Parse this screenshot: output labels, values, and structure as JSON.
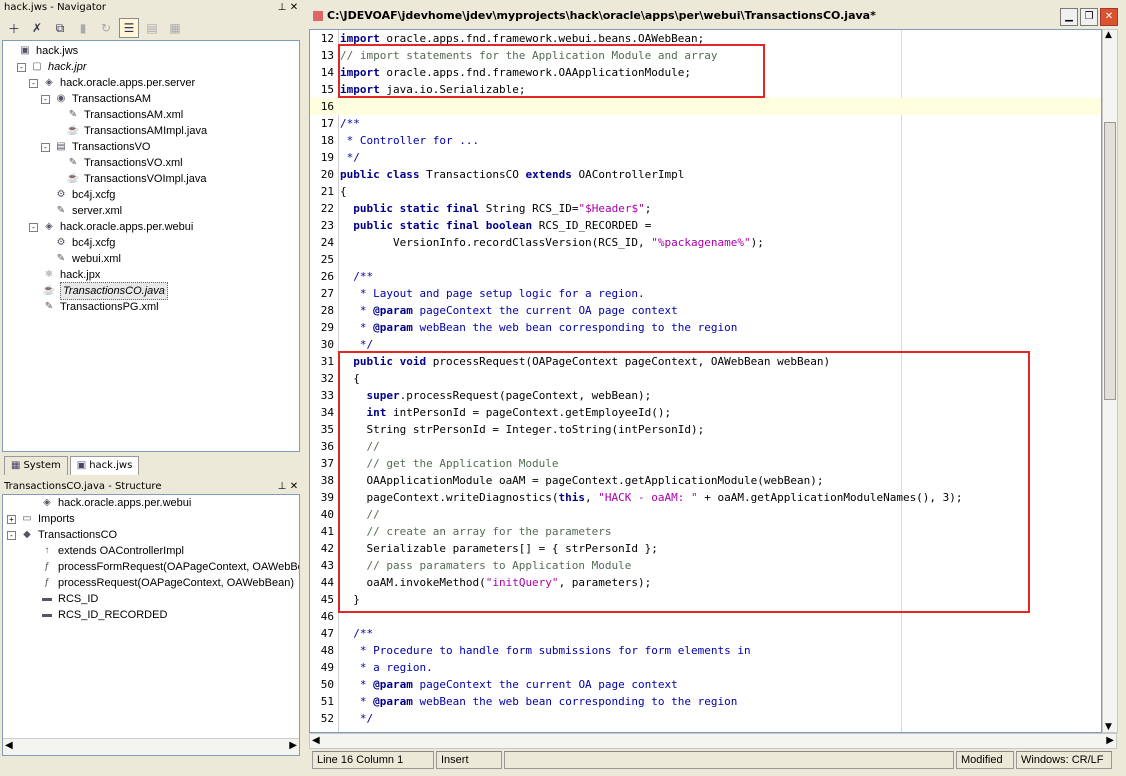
{
  "navigator": {
    "title": "hack.jws - Navigator",
    "tree": [
      {
        "label": "hack.jws",
        "depth": 0,
        "icon": "workspace-icon",
        "expand": ""
      },
      {
        "label": "hack.jpr",
        "depth": 1,
        "icon": "project-icon",
        "expand": "-",
        "italic": true
      },
      {
        "label": "hack.oracle.apps.per.server",
        "depth": 2,
        "icon": "package-icon",
        "expand": "-"
      },
      {
        "label": "TransactionsAM",
        "depth": 3,
        "icon": "app-module-icon",
        "expand": "-"
      },
      {
        "label": "TransactionsAM.xml",
        "depth": 4,
        "icon": "xml-file-icon",
        "expand": ""
      },
      {
        "label": "TransactionsAMImpl.java",
        "depth": 4,
        "icon": "java-file-icon",
        "expand": ""
      },
      {
        "label": "TransactionsVO",
        "depth": 3,
        "icon": "view-object-icon",
        "expand": "-"
      },
      {
        "label": "TransactionsVO.xml",
        "depth": 4,
        "icon": "xml-file-icon",
        "expand": ""
      },
      {
        "label": "TransactionsVOImpl.java",
        "depth": 4,
        "icon": "java-file-icon",
        "expand": ""
      },
      {
        "label": "bc4j.xcfg",
        "depth": 3,
        "icon": "config-file-icon",
        "expand": ""
      },
      {
        "label": "server.xml",
        "depth": 3,
        "icon": "xml-file-icon",
        "expand": ""
      },
      {
        "label": "hack.oracle.apps.per.webui",
        "depth": 2,
        "icon": "package-icon",
        "expand": "-"
      },
      {
        "label": "bc4j.xcfg",
        "depth": 3,
        "icon": "config-file-icon",
        "expand": ""
      },
      {
        "label": "webui.xml",
        "depth": 3,
        "icon": "xml-file-icon",
        "expand": ""
      },
      {
        "label": "hack.jpx",
        "depth": 2,
        "icon": "jpx-file-icon",
        "expand": ""
      },
      {
        "label": "TransactionsCO.java",
        "depth": 2,
        "icon": "java-file-icon",
        "expand": "",
        "italic": true,
        "selected": true
      },
      {
        "label": "TransactionsPG.xml",
        "depth": 2,
        "icon": "xml-file-icon",
        "expand": ""
      }
    ],
    "tabs": [
      {
        "label": "System",
        "icon": "system-icon"
      },
      {
        "label": "hack.jws",
        "icon": "workspace-icon",
        "active": true
      }
    ]
  },
  "structure": {
    "title": "TransactionsCO.java - Structure",
    "tree": [
      {
        "label": "hack.oracle.apps.per.webui",
        "depth": 1,
        "icon": "package-icon",
        "expand": ""
      },
      {
        "label": "Imports",
        "depth": 0,
        "icon": "imports-icon",
        "expand": "+"
      },
      {
        "label": "TransactionsCO",
        "depth": 0,
        "icon": "class-icon",
        "expand": "-"
      },
      {
        "label": "extends OAControllerImpl",
        "depth": 1,
        "icon": "extends-icon",
        "expand": ""
      },
      {
        "label": "processFormRequest(OAPageContext, OAWebBe",
        "depth": 1,
        "icon": "method-icon",
        "expand": ""
      },
      {
        "label": "processRequest(OAPageContext, OAWebBean)",
        "depth": 1,
        "icon": "method-icon",
        "expand": ""
      },
      {
        "label": "RCS_ID",
        "depth": 1,
        "icon": "field-icon",
        "expand": ""
      },
      {
        "label": "RCS_ID_RECORDED",
        "depth": 1,
        "icon": "field-icon",
        "expand": ""
      }
    ]
  },
  "editor": {
    "title": "C:\\JDEVOAF\\jdevhome\\jdev\\myprojects\\hack\\oracle\\apps\\per\\webui\\TransactionsCO.java*",
    "current_line": 16,
    "lines": [
      {
        "n": "12",
        "t": "import oracle.apps.fnd.framework.webui.beans.OAWebBean;"
      },
      {
        "n": "13",
        "t": "// import statements for the Application Module and array"
      },
      {
        "n": "14",
        "t": "import oracle.apps.fnd.framework.OAApplicationModule;"
      },
      {
        "n": "15",
        "t": "import java.io.Serializable;"
      },
      {
        "n": "16",
        "t": ""
      },
      {
        "n": "17",
        "t": "/**"
      },
      {
        "n": "18",
        "t": " * Controller for ..."
      },
      {
        "n": "19",
        "t": " */"
      },
      {
        "n": "20",
        "t": "public class TransactionsCO extends OAControllerImpl"
      },
      {
        "n": "21",
        "t": "{"
      },
      {
        "n": "22",
        "t": "  public static final String RCS_ID=\"$Header$\";"
      },
      {
        "n": "23",
        "t": "  public static final boolean RCS_ID_RECORDED ="
      },
      {
        "n": "24",
        "t": "        VersionInfo.recordClassVersion(RCS_ID, \"%packagename%\");"
      },
      {
        "n": "25",
        "t": ""
      },
      {
        "n": "26",
        "t": "  /**"
      },
      {
        "n": "27",
        "t": "   * Layout and page setup logic for a region."
      },
      {
        "n": "28",
        "t": "   * @param pageContext the current OA page context"
      },
      {
        "n": "29",
        "t": "   * @param webBean the web bean corresponding to the region"
      },
      {
        "n": "30",
        "t": "   */"
      },
      {
        "n": "31",
        "t": "  public void processRequest(OAPageContext pageContext, OAWebBean webBean)"
      },
      {
        "n": "32",
        "t": "  {"
      },
      {
        "n": "33",
        "t": "    super.processRequest(pageContext, webBean);"
      },
      {
        "n": "34",
        "t": "    int intPersonId = pageContext.getEmployeeId();"
      },
      {
        "n": "35",
        "t": "    String strPersonId = Integer.toString(intPersonId);"
      },
      {
        "n": "36",
        "t": "    //"
      },
      {
        "n": "37",
        "t": "    // get the Application Module"
      },
      {
        "n": "38",
        "t": "    OAApplicationModule oaAM = pageContext.getApplicationModule(webBean);"
      },
      {
        "n": "39",
        "t": "    pageContext.writeDiagnostics(this, \"HACK - oaAM: \" + oaAM.getApplicationModuleNames(), 3);"
      },
      {
        "n": "40",
        "t": "    //"
      },
      {
        "n": "41",
        "t": "    // create an array for the parameters"
      },
      {
        "n": "42",
        "t": "    Serializable parameters[] = { strPersonId };"
      },
      {
        "n": "43",
        "t": "    // pass paramaters to Application Module"
      },
      {
        "n": "44",
        "t": "    oaAM.invokeMethod(\"initQuery\", parameters);"
      },
      {
        "n": "45",
        "t": "  }"
      },
      {
        "n": "46",
        "t": ""
      },
      {
        "n": "47",
        "t": "  /**"
      },
      {
        "n": "48",
        "t": "   * Procedure to handle form submissions for form elements in"
      },
      {
        "n": "49",
        "t": "   * a region."
      },
      {
        "n": "50",
        "t": "   * @param pageContext the current OA page context"
      },
      {
        "n": "51",
        "t": "   * @param webBean the web bean corresponding to the region"
      },
      {
        "n": "52",
        "t": "   */"
      }
    ]
  },
  "status": {
    "position": "Line 16 Column 1",
    "mode": "Insert",
    "modified": "Modified",
    "line_ending": "Windows: CR/LF"
  },
  "colors": {
    "highlight_box": "#e32626",
    "keyword": "#00008b",
    "comment": "#556b55",
    "string": "#aa00aa"
  }
}
